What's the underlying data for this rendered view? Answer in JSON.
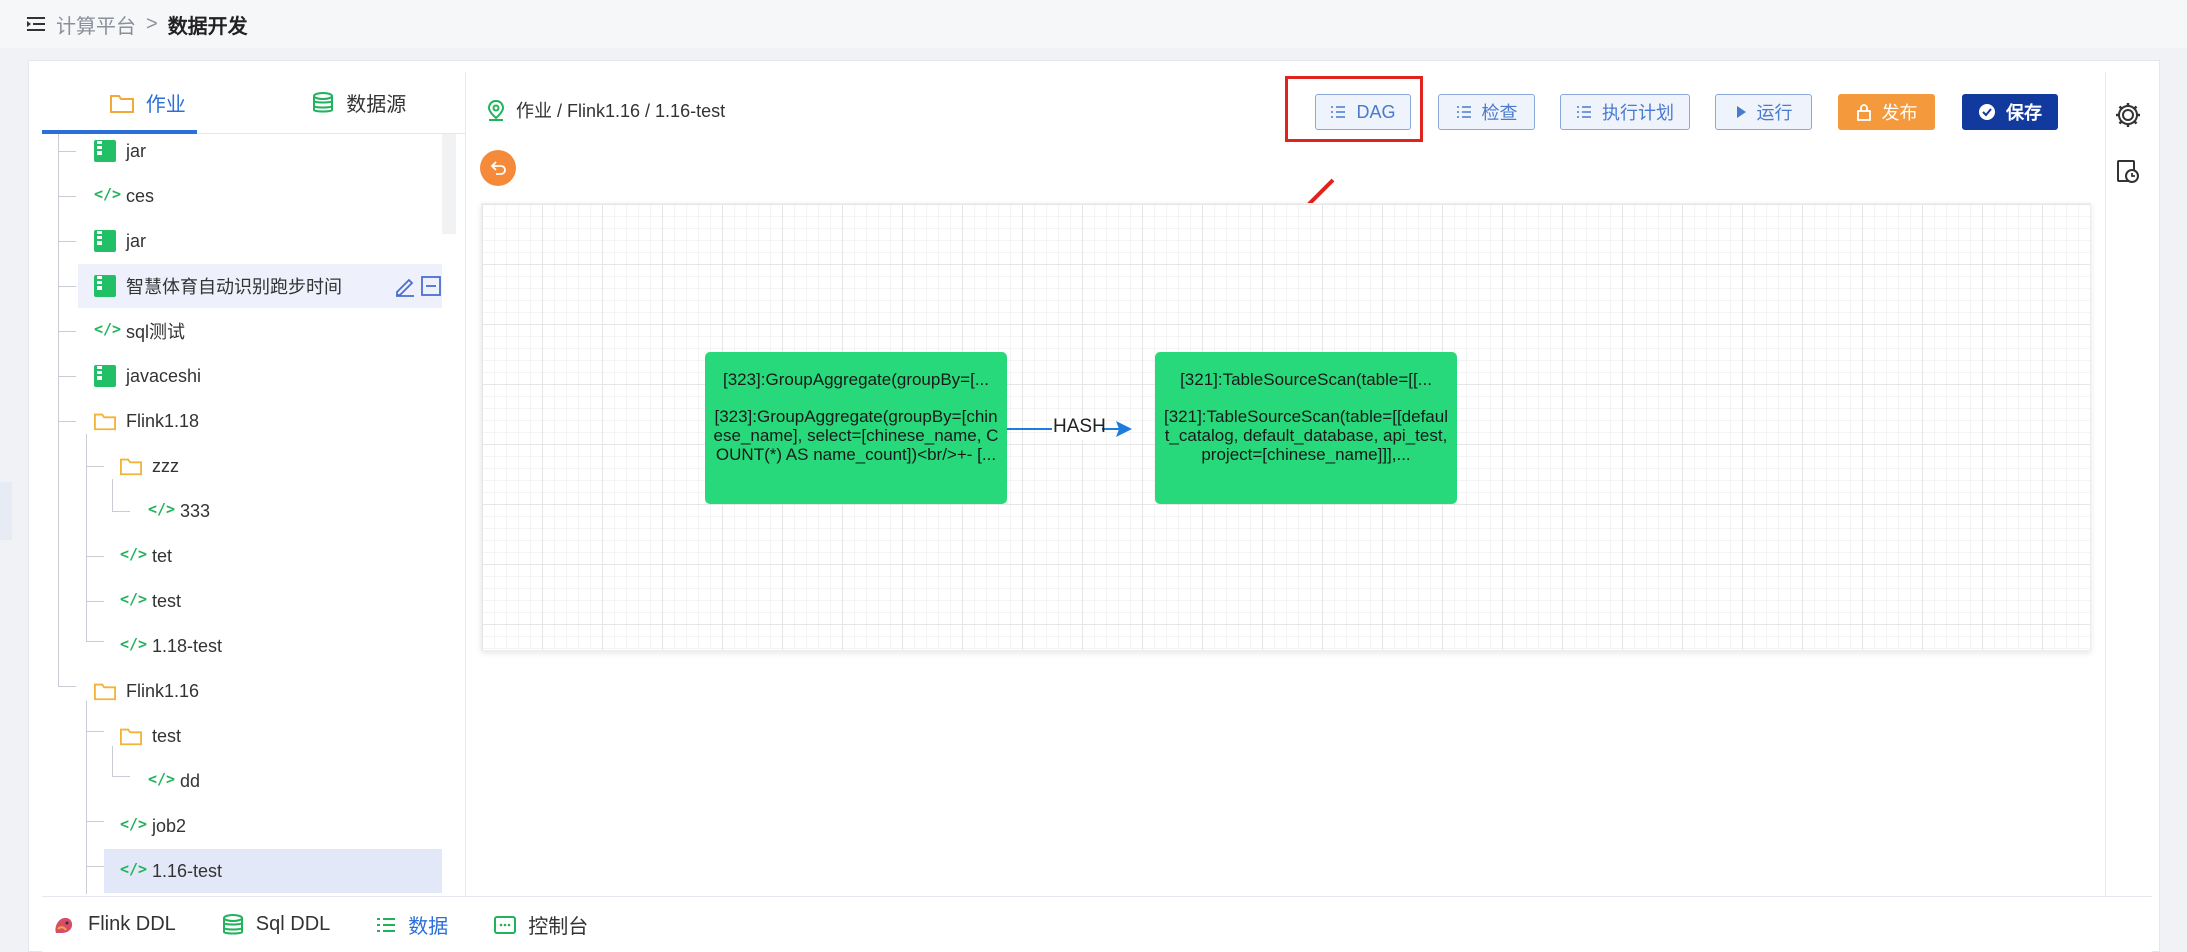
{
  "breadcrumb": {
    "root": "计算平台",
    "separator": ">",
    "current": "数据开发"
  },
  "left_tabs": [
    {
      "label": "作业"
    },
    {
      "label": "数据源"
    }
  ],
  "tree": [
    {
      "label": "jar",
      "type": "jar"
    },
    {
      "label": "ces",
      "type": "code"
    },
    {
      "label": "jar",
      "type": "jar"
    },
    {
      "label": "智慧体育自动识别跑步时间",
      "type": "jar"
    },
    {
      "label": "sql测试",
      "type": "code"
    },
    {
      "label": "javaceshi",
      "type": "jar"
    },
    {
      "label": "Flink1.18",
      "type": "folder"
    },
    {
      "label": "zzz",
      "type": "folder"
    },
    {
      "label": "333",
      "type": "code"
    },
    {
      "label": "tet",
      "type": "code"
    },
    {
      "label": "test",
      "type": "code"
    },
    {
      "label": "1.18-test",
      "type": "code"
    },
    {
      "label": "Flink1.16",
      "type": "folder"
    },
    {
      "label": "test",
      "type": "folder"
    },
    {
      "label": "dd",
      "type": "code"
    },
    {
      "label": "job2",
      "type": "code"
    },
    {
      "label": "1.16-test",
      "type": "code"
    }
  ],
  "path": "作业 / Flink1.16 / 1.16-test",
  "toolbar": {
    "dag": "DAG",
    "check": "检查",
    "plan": "执行计划",
    "run": "运行",
    "publish": "发布",
    "save": "保存"
  },
  "dag": {
    "node1_title": "[323]:GroupAggregate(groupBy=[...",
    "node1_body": "[323]:GroupAggregate(groupBy=[chinese_name], select=[chinese_name, COUNT(*) AS name_count])<br/>+- [...",
    "edge_label": "HASH",
    "node2_title": "[321]:TableSourceScan(table=[[...",
    "node2_body": "[321]:TableSourceScan(table=[[default_catalog, default_database, api_test, project=[chinese_name]]],..."
  },
  "bottom_tabs": [
    {
      "label": "Flink DDL"
    },
    {
      "label": "Sql DDL"
    },
    {
      "label": "数据"
    },
    {
      "label": "控制台"
    }
  ],
  "colors": {
    "accent": "#2b6fd8",
    "node": "#27d97a",
    "highlight_box": "#e0231d",
    "publish": "#f49a3c",
    "save": "#123a9e"
  }
}
